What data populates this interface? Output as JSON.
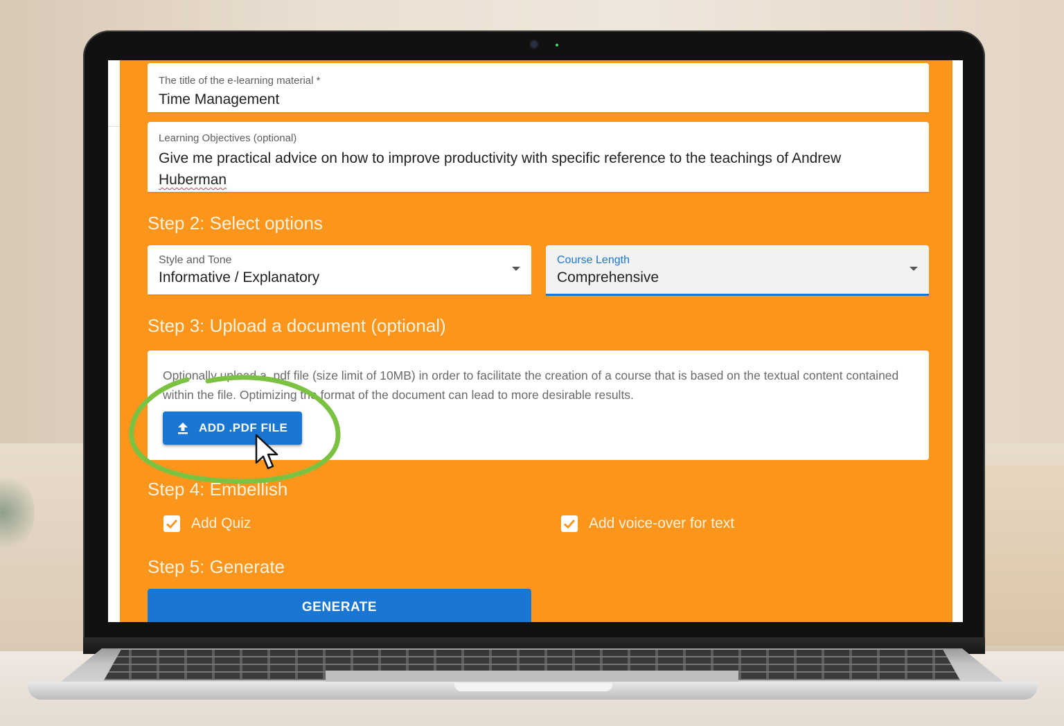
{
  "form": {
    "title_field": {
      "label": "The title of the e-learning material *",
      "value": "Time Management"
    },
    "objectives_field": {
      "label": "Learning Objectives (optional)",
      "value_line1": "Give me practical advice on how to improve productivity with specific reference to the teachings of Andrew",
      "value_line2": "Huberman"
    },
    "step2": {
      "heading": "Step 2: Select options",
      "style_select": {
        "label": "Style and Tone",
        "value": "Informative / Explanatory"
      },
      "length_select": {
        "label": "Course Length",
        "value": "Comprehensive"
      }
    },
    "step3": {
      "heading": "Step 3: Upload a document (optional)",
      "description": "Optionally upload a .pdf file (size limit of 10MB) in order to facilitate the creation of a course that is based on the textual content contained within the file. Optimizing the format of the document can lead to more desirable results.",
      "upload_button": "ADD .PDF FILE"
    },
    "step4": {
      "heading": "Step 4: Embellish",
      "quiz": {
        "label": "Add Quiz",
        "checked": true
      },
      "voiceover": {
        "label": "Add voice-over for text",
        "checked": true
      }
    },
    "step5": {
      "heading": "Step 5: Generate",
      "button": "GENERATE"
    }
  },
  "icons": {
    "upload": "upload-icon",
    "dropdown": "chevron-down-icon",
    "checkbox": "check-icon",
    "cursor": "cursor-icon"
  },
  "colors": {
    "page_background": "#fb951b",
    "primary": "#1976d2",
    "highlight_circle": "#7cc242"
  }
}
